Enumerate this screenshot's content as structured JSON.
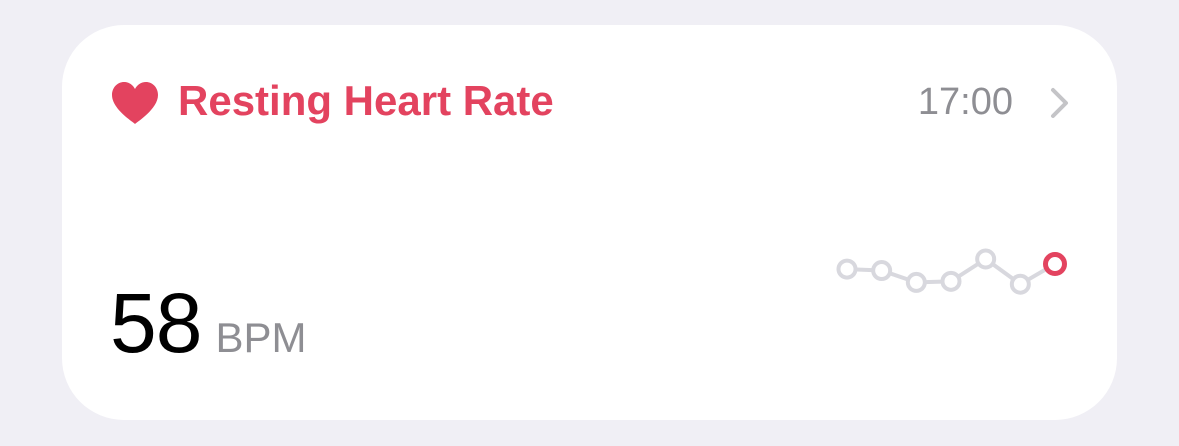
{
  "card": {
    "title": "Resting Heart Rate",
    "time": "17:00",
    "value": "58",
    "unit": "BPM"
  },
  "icons": {
    "title_icon": "heart-icon",
    "nav_icon": "chevron-right-icon"
  },
  "colors": {
    "background": "#F0EFF5",
    "card": "#FFFFFF",
    "accent": "#E3435F",
    "secondary_text": "#8E8E93",
    "sparkline": "#D8D8DE",
    "chevron": "#C4C4C7"
  },
  "sparkline": {
    "values": [
      0.72,
      0.68,
      0.35,
      0.38,
      1.0,
      0.3,
      0.86
    ],
    "highlight_last": true
  }
}
